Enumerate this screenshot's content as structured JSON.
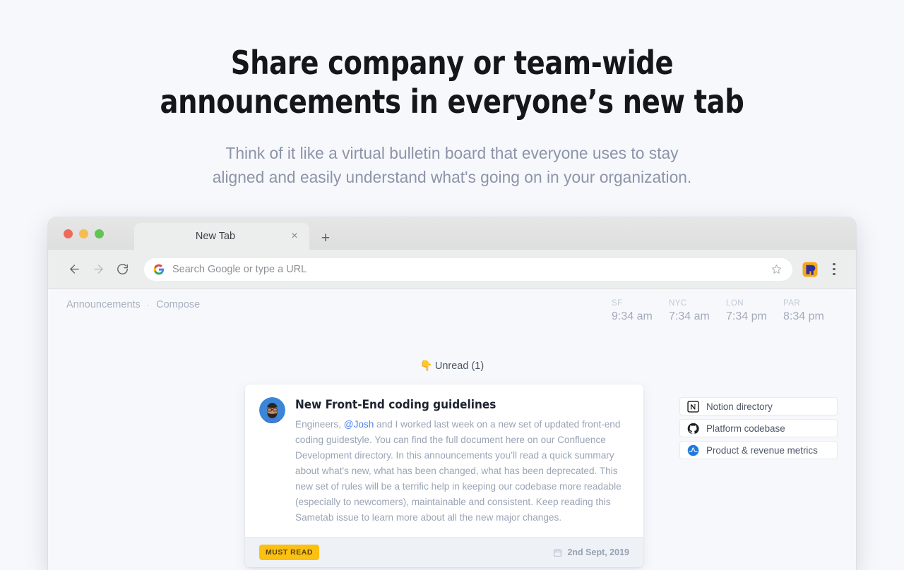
{
  "hero": {
    "title_line1": "Share company or team-wide",
    "title_line2": "announcements in everyone’s new tab",
    "subtitle_line1": "Think of it like a virtual bulletin board that everyone uses to stay",
    "subtitle_line2": "aligned and easily understand what's going on in your organization."
  },
  "browser": {
    "tab": {
      "title": "New Tab",
      "close_label": "×"
    },
    "new_tab_label": "+",
    "back_label": "←",
    "forward_label": "→",
    "reload_label": "↻",
    "omnibox": {
      "placeholder": "Search Google or type a URL",
      "value": ""
    },
    "extension_name": "Sametab",
    "menu_label": "⋮"
  },
  "app": {
    "breadcrumb": {
      "announcements": "Announcements",
      "separator": "·",
      "compose": "Compose"
    },
    "clocks": [
      {
        "city": "SF",
        "time": "9:34 am"
      },
      {
        "city": "NYC",
        "time": "7:34 am"
      },
      {
        "city": "LON",
        "time": "7:34 pm"
      },
      {
        "city": "PAR",
        "time": "8:34 pm"
      }
    ],
    "unread": {
      "emoji": "👇",
      "label": "Unread (1)"
    },
    "card": {
      "title": "New Front-End coding guidelines",
      "body_before_mention": "Engineers, ",
      "mention": "@Josh",
      "body_after_mention": " and I worked last week on a new set of updated front-end coding guidestyle. You can find the full document here on our Confluence Development directory. In this announcements you’ll read a quick summary about what's new, what has been changed, what has been deprecated. This new set of rules will be a terrific help in keeping our codebase more readable (especially to newcomers), maintainable and consistent. Keep reading this Sametab issue to learn more about all the new major changes.",
      "badge": "MUST READ",
      "date": "2nd Sept, 2019"
    },
    "rail": [
      {
        "label": "Notion directory",
        "icon": "notion-icon"
      },
      {
        "label": "Platform codebase",
        "icon": "github-icon"
      },
      {
        "label": "Product & revenue metrics",
        "icon": "amplitude-icon"
      }
    ]
  },
  "colors": {
    "page_bg": "#f7f8fc",
    "accent_link": "#4a7ef0",
    "badge_bg": "#fbc012",
    "heading": "#15161a"
  }
}
